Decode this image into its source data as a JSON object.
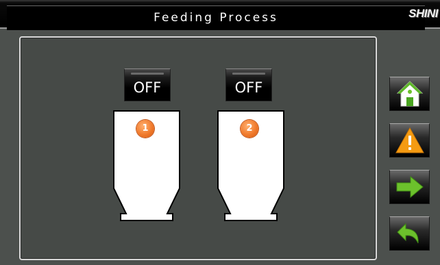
{
  "header": {
    "title": "Feeding Process",
    "logo_text": "SHINI"
  },
  "hoppers": [
    {
      "number": "1",
      "switch_label": "OFF"
    },
    {
      "number": "2",
      "switch_label": "OFF"
    }
  ],
  "nav": {
    "icons": [
      "home-icon",
      "warning-icon",
      "next-arrow-icon",
      "back-arrow-icon"
    ]
  },
  "colors": {
    "background": "#4c504d",
    "badge": "#f07a2c",
    "nav_green": "#6cc12c",
    "warning_orange": "#f59b12"
  }
}
